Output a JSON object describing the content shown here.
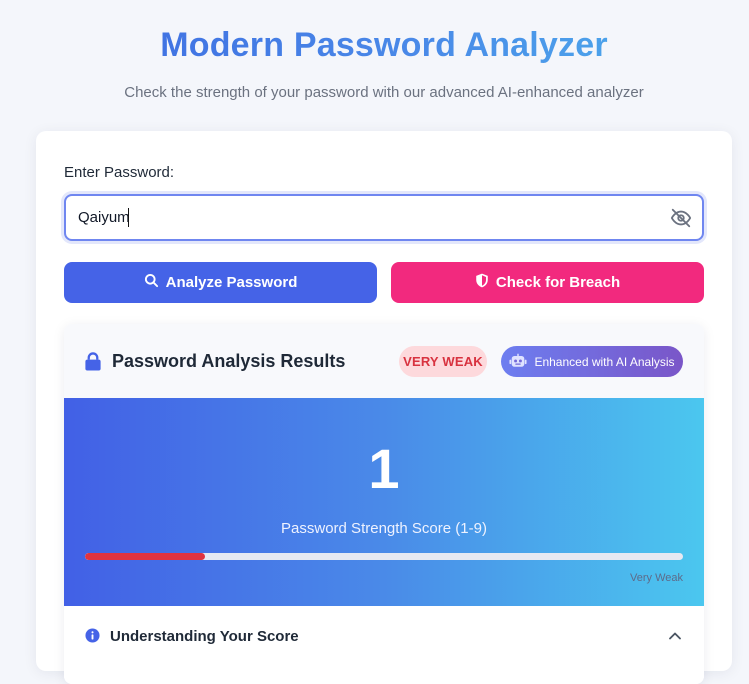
{
  "header": {
    "title": "Modern Password Analyzer",
    "subtitle": "Check the strength of your password with our advanced AI-enhanced analyzer"
  },
  "form": {
    "label": "Enter Password:",
    "password_value": "Qaiyum",
    "toggle_icon": "eye-slash-icon"
  },
  "buttons": {
    "analyze_label": "Analyze Password",
    "analyze_icon": "search-icon",
    "analyze_color": "#4563e7",
    "breach_label": "Check for Breach",
    "breach_icon": "shield-icon",
    "breach_color": "#f2297e"
  },
  "results": {
    "header_icon": "lock-icon",
    "title": "Password Analysis Results",
    "strength_badge": "VERY WEAK",
    "ai_badge": "Enhanced with AI Analysis",
    "ai_badge_icon": "robot-icon",
    "score": "1",
    "score_label": "Password Strength Score (1-9)",
    "score_value": 1,
    "score_max": 9,
    "progress_fraction": 0.2,
    "progress_color": "#e03340",
    "progress_caption": "Very Weak"
  },
  "understanding": {
    "icon": "info-circle-icon",
    "title": "Understanding Your Score",
    "expanded": true
  }
}
